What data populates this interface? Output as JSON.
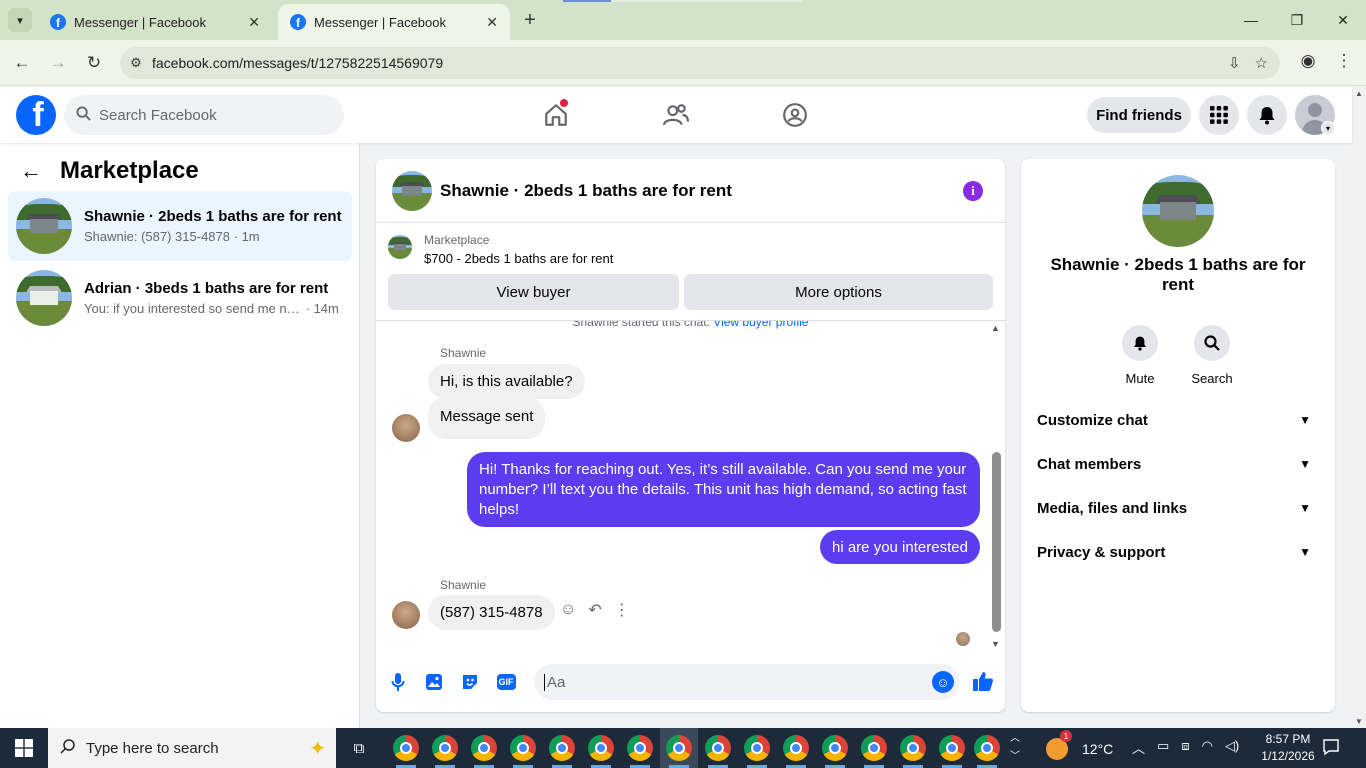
{
  "browser": {
    "tabs": [
      {
        "title": "Messenger | Facebook",
        "active": false
      },
      {
        "title": "Messenger | Facebook",
        "active": true
      }
    ],
    "url": "facebook.com/messages/t/1275822514569079"
  },
  "fb_header": {
    "search_placeholder": "Search Facebook",
    "find_friends": "Find friends"
  },
  "left_panel": {
    "title": "Marketplace",
    "conversations": [
      {
        "name": "Shawnie · 2beds 1 baths are for rent",
        "snippet": "Shawnie: (587) 315-4878",
        "time": "1m",
        "selected": true
      },
      {
        "name": "Adrian · 3beds 1 baths are for rent",
        "snippet": "You: if you interested so send me nu...",
        "time": "14m",
        "selected": false
      }
    ]
  },
  "chat": {
    "title": "Shawnie · 2beds 1 baths are for rent",
    "listing_source": "Marketplace",
    "listing_price": "$700 - 2beds 1 baths are for rent",
    "view_buyer": "View buyer",
    "more_options": "More options",
    "started_note": "Shawnie started this chat.",
    "started_link": "View buyer profile",
    "messages": [
      {
        "sender": "Shawnie",
        "text": "Hi, is this available?",
        "dir": "in"
      },
      {
        "text": "Message sent",
        "dir": "in"
      },
      {
        "text": "Hi! Thanks for reaching out. Yes, it’s still available. Can you send me your number? I’ll text you the details. This unit has high demand, so acting fast helps!",
        "dir": "out"
      },
      {
        "text": "hi are you interested",
        "dir": "out"
      },
      {
        "sender": "Shawnie",
        "text": "(587) 315-4878",
        "dir": "in"
      }
    ],
    "composer_placeholder": "Aa"
  },
  "right_panel": {
    "name": "Shawnie · 2beds 1 baths are for rent",
    "actions": [
      "Mute",
      "Search"
    ],
    "sections": [
      "Customize chat",
      "Chat members",
      "Media, files and links",
      "Privacy & support"
    ]
  },
  "taskbar": {
    "search_placeholder": "Type here to search",
    "weather_temp": "12°C",
    "weather_badge": "1",
    "time": "8:57 PM",
    "date": "1/12/2026"
  },
  "colors": {
    "fb_blue": "#0866ff",
    "outgoing_bubble": "#5b3cf0",
    "selected_conv": "#ebf5ff"
  }
}
